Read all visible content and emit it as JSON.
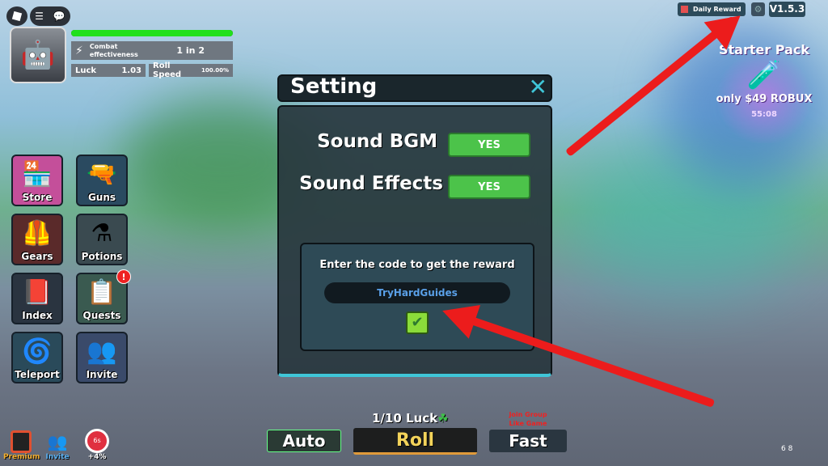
{
  "top_left": {
    "roblox_icon": "roblox-logo-icon",
    "menu_icon": "hamburger-icon",
    "chat_icon": "chat-icon"
  },
  "player": {
    "health_fraction": 1.0,
    "combat_label": "Combat effectiveness",
    "combat_value": "1 in 2",
    "luck_label": "Luck",
    "luck_value": "1.03",
    "roll_speed_label": "Roll Speed",
    "roll_speed_value": "100.00%"
  },
  "side_menu": [
    {
      "label": "Store",
      "icon": "store-icon"
    },
    {
      "label": "Guns",
      "icon": "gun-icon"
    },
    {
      "label": "Gears",
      "icon": "armor-icon"
    },
    {
      "label": "Potions",
      "icon": "potion-icon"
    },
    {
      "label": "Index",
      "icon": "book-icon"
    },
    {
      "label": "Quests",
      "icon": "quest-icon",
      "badge": "!"
    },
    {
      "label": "Teleport",
      "icon": "portal-icon"
    },
    {
      "label": "Invite",
      "icon": "friends-icon"
    }
  ],
  "top_right": {
    "daily_reward": "Daily Reward",
    "version": "V1.5.3",
    "settings_icon": "gear-icon"
  },
  "starter_pack": {
    "title": "Starter Pack",
    "price": "only $49 ROBUX",
    "timer": "55:08"
  },
  "settings": {
    "title": "Setting",
    "sound_bgm_label": "Sound BGM",
    "sound_bgm_value": "YES",
    "sound_effects_label": "Sound Effects",
    "sound_effects_value": "YES",
    "code_prompt": "Enter the code to get the reward",
    "code_value": "TryHardGuides",
    "close_icon": "close-icon",
    "submit_icon": "check-icon"
  },
  "bottom": {
    "luck_text": "1/10 Luck",
    "auto": "Auto",
    "roll": "Roll",
    "fast": "Fast",
    "group_line1": "Join Group",
    "group_line2": "Like Game"
  },
  "bottom_left": {
    "premium": "Premium",
    "invite": "Invite",
    "timer_top": "6s",
    "boost": "+4%"
  },
  "corner_text": "6 8",
  "colors": {
    "yes_green": "#4cc34a",
    "roll_gold": "#f3d35a",
    "arrow_red": "#ec1c1c",
    "close_cyan": "#3fc6d8"
  }
}
